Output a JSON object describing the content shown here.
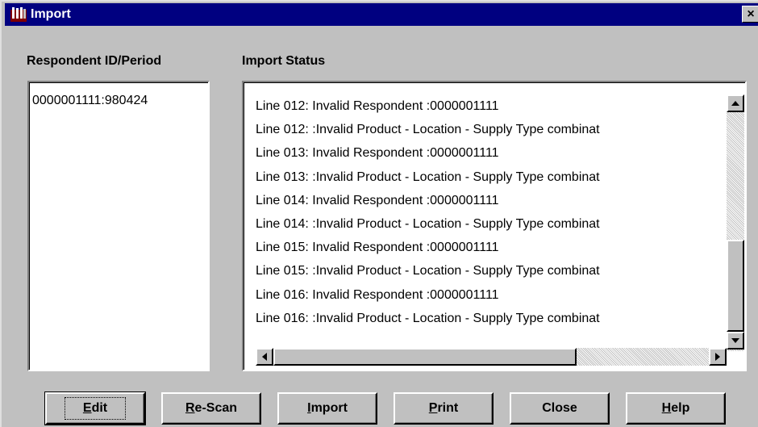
{
  "window": {
    "title": "Import",
    "close_glyph": "×"
  },
  "labels": {
    "respondent": "Respondent ID/Period",
    "status": "Import Status"
  },
  "respondents": [
    "0000001111:980424"
  ],
  "status_lines": [
    "Line 012:  Invalid Respondent :0000001111",
    "Line 012:  :Invalid Product - Location - Supply Type combinat",
    "Line 013:  Invalid Respondent :0000001111",
    "Line 013:  :Invalid Product - Location - Supply Type combinat",
    "Line 014:  Invalid Respondent :0000001111",
    "Line 014:  :Invalid Product - Location - Supply Type combinat",
    "Line 015:  Invalid Respondent :0000001111",
    "Line 015:  :Invalid Product - Location - Supply Type combinat",
    "Line 016:  Invalid Respondent :0000001111",
    "Line 016:  :Invalid Product - Location - Supply Type combinat"
  ],
  "buttons": {
    "edit": {
      "mnemonic": "E",
      "rest": "dit"
    },
    "rescan": {
      "mnemonic": "R",
      "rest": "e-Scan"
    },
    "import": {
      "mnemonic": "I",
      "rest": "mport"
    },
    "print": {
      "mnemonic": "P",
      "rest": "rint"
    },
    "close": {
      "label": "Close"
    },
    "help": {
      "mnemonic": "H",
      "rest": "elp"
    }
  },
  "icons": {
    "app": "import-app-icon",
    "scroll_up": "arrow-up-icon",
    "scroll_down": "arrow-down-icon",
    "scroll_left": "arrow-left-icon",
    "scroll_right": "arrow-right-icon"
  }
}
